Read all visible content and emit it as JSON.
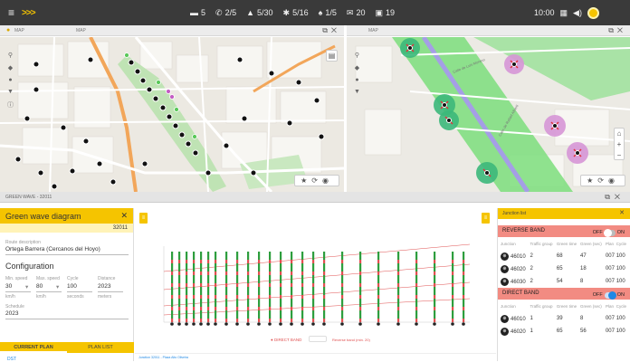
{
  "topbar": {
    "stats": [
      {
        "icon": "monitor-icon",
        "glyph": "▬",
        "value": "5"
      },
      {
        "icon": "phone-icon",
        "glyph": "✆",
        "value": "2/5"
      },
      {
        "icon": "warning-icon",
        "glyph": "▲",
        "value": "5/30"
      },
      {
        "icon": "gear-icon",
        "glyph": "✱",
        "value": "5/16"
      },
      {
        "icon": "bell-icon",
        "glyph": "♠",
        "value": "1/5"
      },
      {
        "icon": "mail-icon",
        "glyph": "✉",
        "value": "20"
      },
      {
        "icon": "calendar-icon",
        "glyph": "▣",
        "value": "19"
      }
    ],
    "time": "10:00"
  },
  "map_left": {
    "tab1": "MAP",
    "tab2": "MAP"
  },
  "map_right": {
    "tab1": "MAP"
  },
  "map_labels": {
    "l1": "Calle de Luis Moreno",
    "l2": "Calle de Rafael Alberti"
  },
  "bottom": {
    "title": "GREEN WAVE - 32011"
  },
  "left_panel": {
    "title": "Green wave diagram",
    "id": "32011",
    "route_label": "Route description",
    "route_value": "Ortega Barrera (Cercanos del Hoyo)",
    "configuration": "Configuration",
    "min_speed_label": "Min. speed",
    "min_speed": "30",
    "max_speed_label": "Max. speed",
    "max_speed": "80",
    "cycle_label": "Cycle",
    "cycle": "100",
    "distance_label": "Distance",
    "distance": "2023",
    "unit_kmh": "km/h",
    "unit_kmh2": "km/h",
    "unit_sec": "seconds",
    "unit_m": "meters",
    "schedule_label": "Schedule",
    "schedule": "2023",
    "tab_current": "CURRENT PLAN",
    "tab_list": "PLAN LIST",
    "bottom_item": "DST"
  },
  "chart": {
    "legend_direct": "DIRECT BAND",
    "legend_reverse": "Reverse band (min. 20)",
    "footer_left": "Junction 32011 - Plaza Alto Oliveira"
  },
  "right_panel": {
    "title": "Junction list",
    "reverse_band": "REVERSE BAND",
    "direct_band": "DIRECT BAND",
    "off": "OFF",
    "on": "ON",
    "cols": [
      "Junction",
      "Traffic group",
      "Green time",
      "Green (sec)",
      "Plan",
      "Cycle"
    ],
    "reverse_rows": [
      [
        "46010",
        "2",
        "68",
        "47",
        "007",
        "100"
      ],
      [
        "46020",
        "2",
        "65",
        "18",
        "007",
        "100"
      ],
      [
        "46030",
        "2",
        "54",
        "8",
        "007",
        "100"
      ]
    ],
    "direct_rows": [
      [
        "46010",
        "1",
        "39",
        "8",
        "007",
        "100"
      ],
      [
        "46020",
        "1",
        "65",
        "56",
        "007",
        "100"
      ]
    ]
  }
}
